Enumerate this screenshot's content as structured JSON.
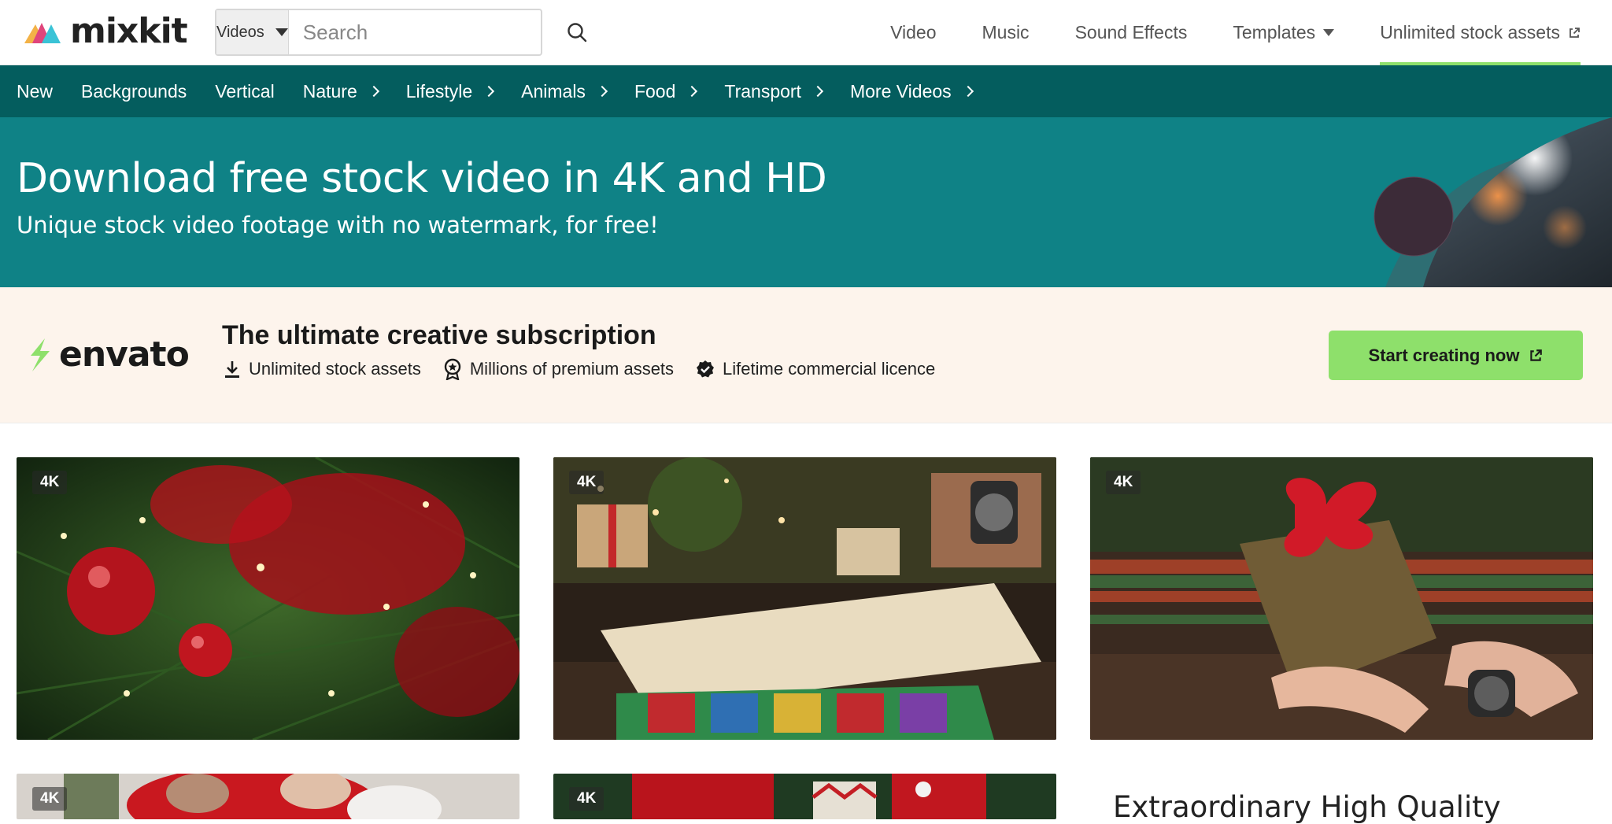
{
  "brand": {
    "name": "mixkit",
    "colors": {
      "accent": "#8ee06b",
      "catbar": "#045d5e",
      "hero": "#0f8286",
      "promo_bg": "#fdf4ec"
    }
  },
  "search": {
    "type_label": "Videos",
    "placeholder": "Search",
    "value": ""
  },
  "nav": {
    "items": [
      {
        "label": "Video"
      },
      {
        "label": "Music"
      },
      {
        "label": "Sound Effects"
      },
      {
        "label": "Templates"
      },
      {
        "label": "Unlimited stock assets"
      }
    ]
  },
  "categories": [
    {
      "label": "New"
    },
    {
      "label": "Backgrounds"
    },
    {
      "label": "Vertical"
    },
    {
      "label": "Nature"
    },
    {
      "label": "Lifestyle"
    },
    {
      "label": "Animals"
    },
    {
      "label": "Food"
    },
    {
      "label": "Transport"
    },
    {
      "label": "More Videos"
    }
  ],
  "hero": {
    "title": "Download free stock video in 4K and HD",
    "subtitle": "Unique stock video footage with no watermark, for free!"
  },
  "promo": {
    "brand": "envato",
    "title": "The ultimate creative subscription",
    "features": [
      {
        "label": "Unlimited stock assets",
        "icon": "download-icon"
      },
      {
        "label": "Millions of premium assets",
        "icon": "award-icon"
      },
      {
        "label": "Lifetime commercial licence",
        "icon": "verified-check-icon"
      }
    ],
    "cta_label": "Start creating now"
  },
  "videos": [
    {
      "badge": "4K"
    },
    {
      "badge": "4K"
    },
    {
      "badge": "4K"
    },
    {
      "badge": "4K"
    },
    {
      "badge": "4K"
    }
  ],
  "side_heading": "Extraordinary High Quality"
}
